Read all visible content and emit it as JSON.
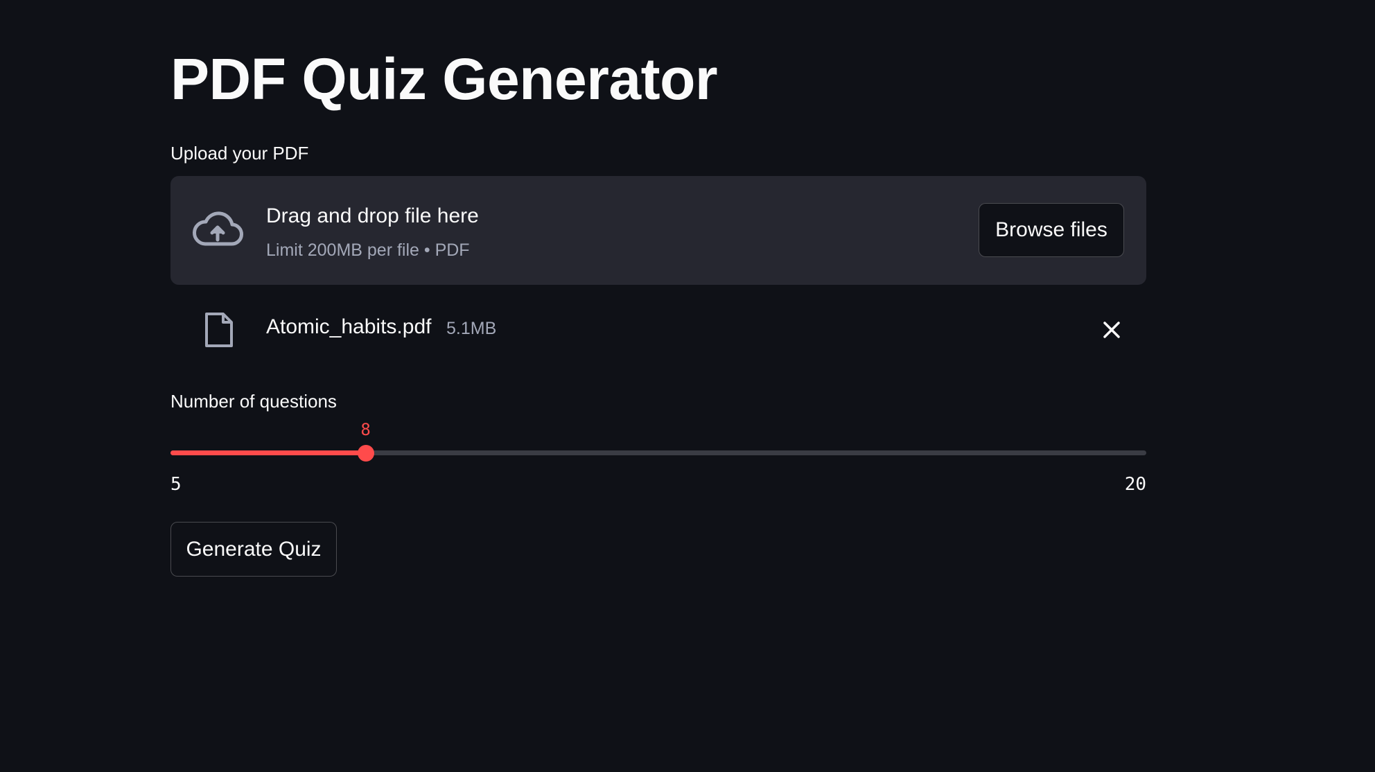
{
  "page": {
    "title": "PDF Quiz Generator"
  },
  "uploader": {
    "label": "Upload your PDF",
    "dropzone_title": "Drag and drop file here",
    "dropzone_subtitle": "Limit 200MB per file • PDF",
    "browse_label": "Browse files",
    "icon": "cloud-upload-icon"
  },
  "uploaded_file": {
    "name": "Atomic_habits.pdf",
    "size": "5.1MB",
    "icon": "file-icon",
    "remove_icon": "close-icon"
  },
  "questions_slider": {
    "label": "Number of questions",
    "min": 5,
    "max": 20,
    "value": 8,
    "min_label": "5",
    "max_label": "20",
    "value_label": "8"
  },
  "actions": {
    "generate_label": "Generate Quiz"
  },
  "colors": {
    "background": "#0f1117",
    "surface": "#262730",
    "accent": "#ff4b4b",
    "text": "#fafafa",
    "muted_text": "#a3a8b8",
    "track": "#3a3c44"
  }
}
